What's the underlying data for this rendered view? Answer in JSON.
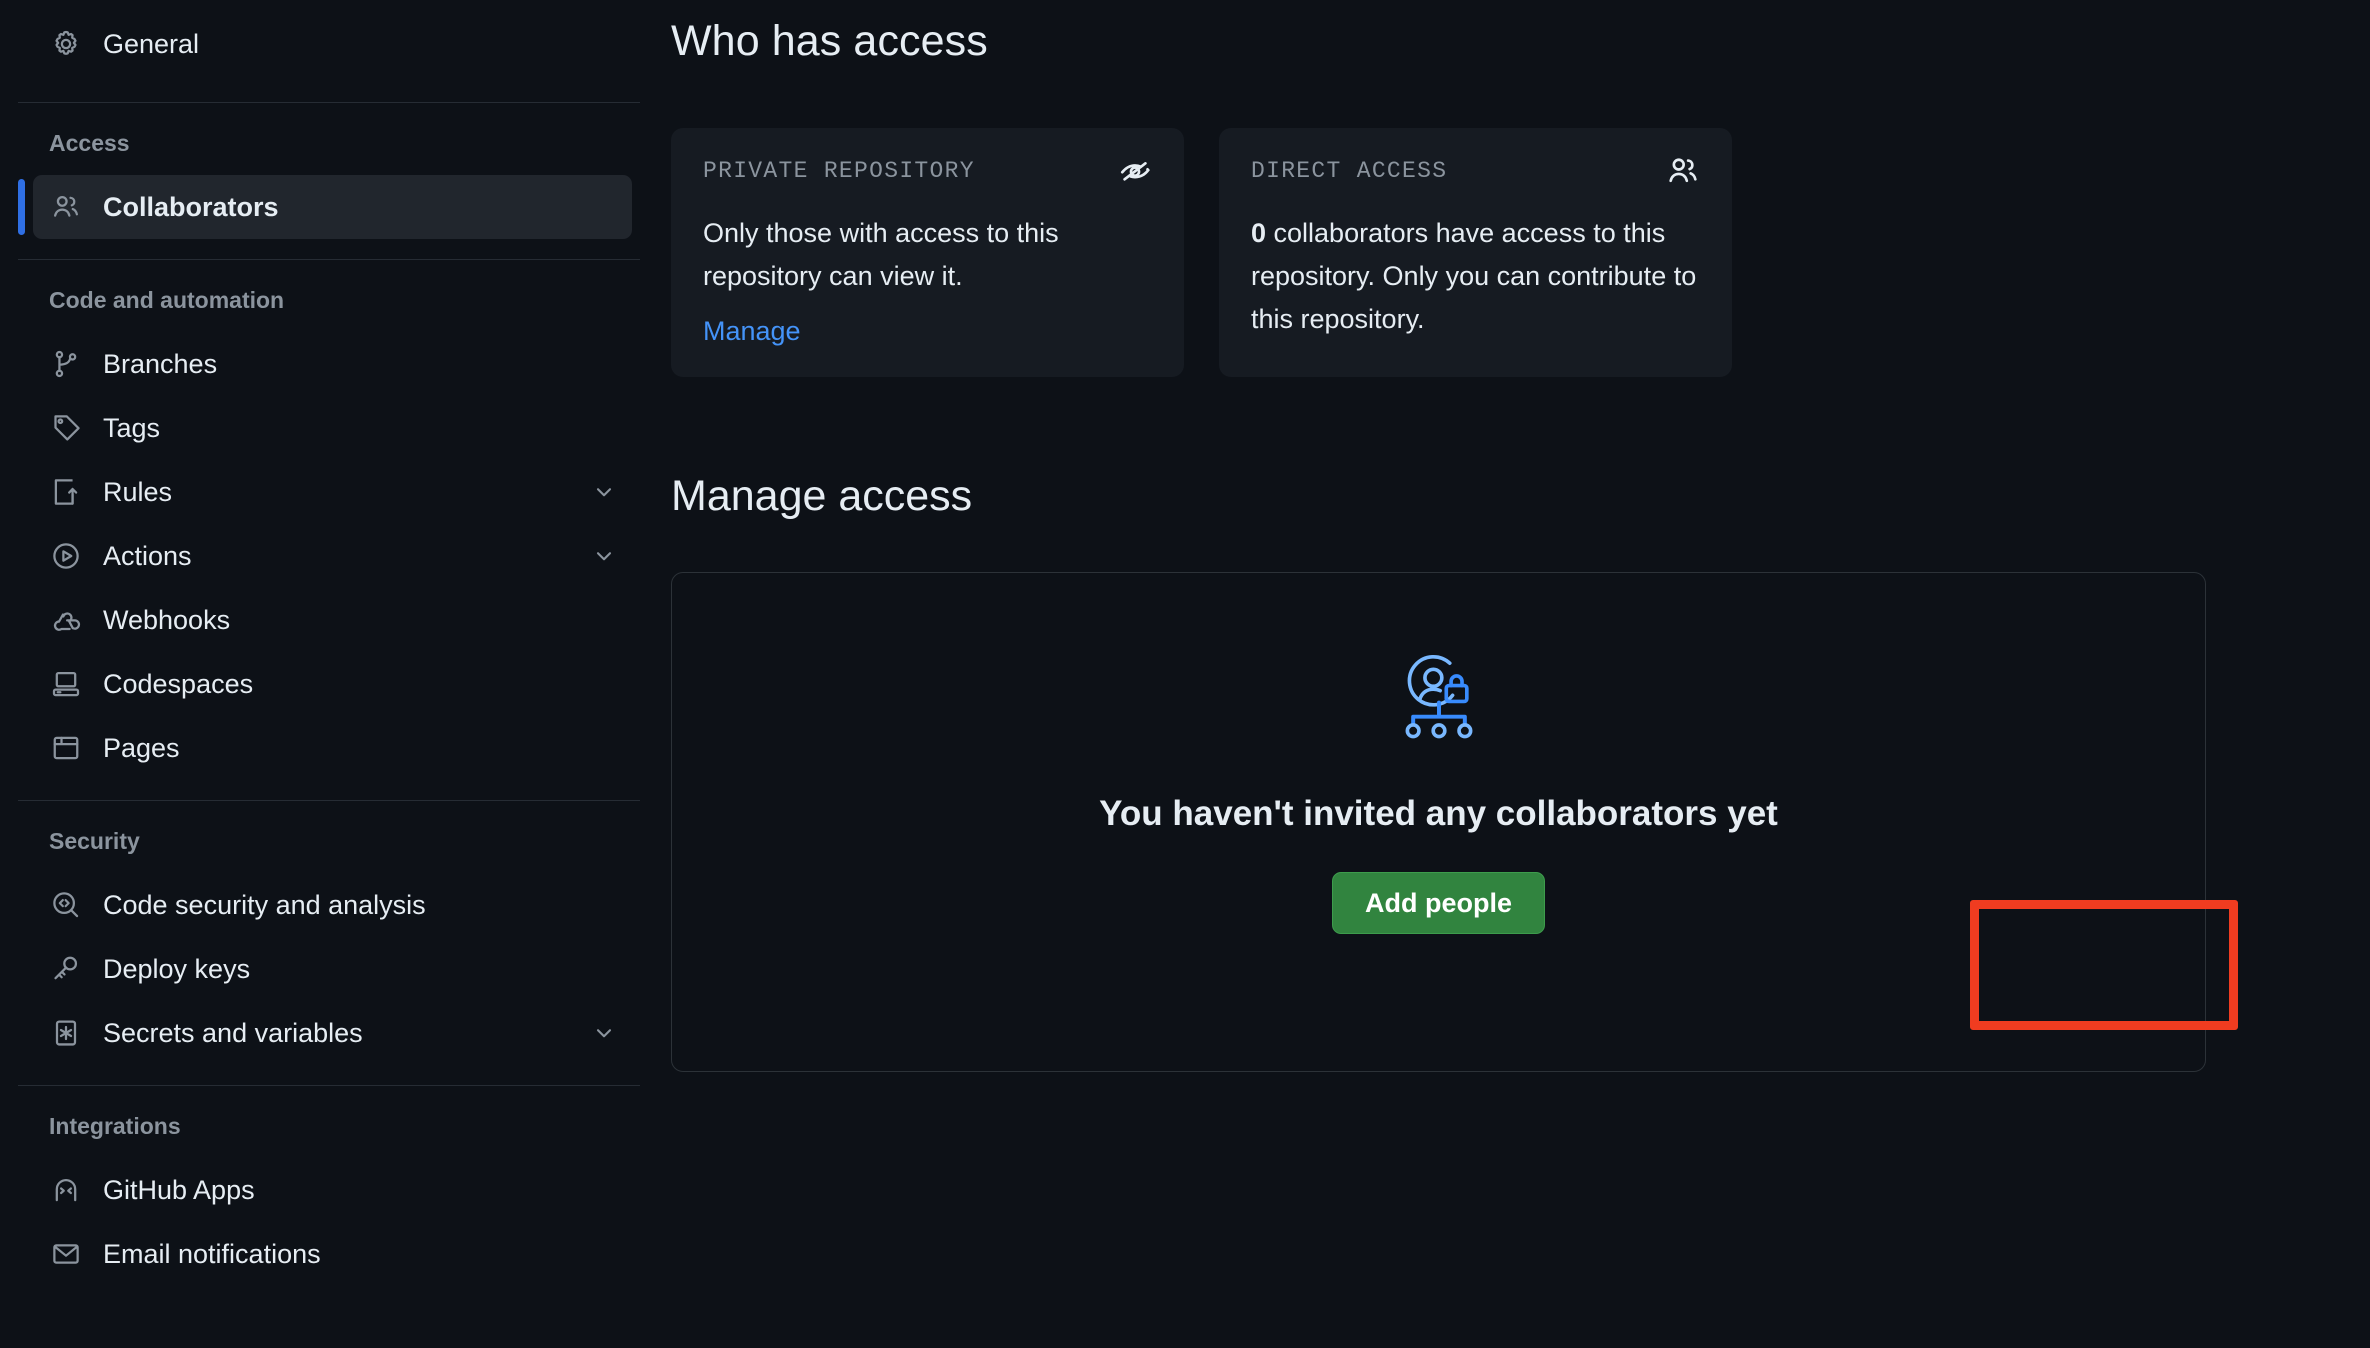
{
  "sidebar": {
    "top_items": [
      {
        "label": "General",
        "icon": "gear-icon",
        "name": "sidebar-item-general"
      }
    ],
    "sections": [
      {
        "title": "Access",
        "name": "sidebar-section-access",
        "items": [
          {
            "label": "Collaborators",
            "icon": "people-icon",
            "name": "sidebar-item-collaborators",
            "active": true,
            "expandable": false
          }
        ]
      },
      {
        "title": "Code and automation",
        "name": "sidebar-section-code-and-automation",
        "items": [
          {
            "label": "Branches",
            "icon": "git-branch-icon",
            "name": "sidebar-item-branches",
            "active": false,
            "expandable": false
          },
          {
            "label": "Tags",
            "icon": "tag-icon",
            "name": "sidebar-item-tags",
            "active": false,
            "expandable": false
          },
          {
            "label": "Rules",
            "icon": "rules-icon",
            "name": "sidebar-item-rules",
            "active": false,
            "expandable": true
          },
          {
            "label": "Actions",
            "icon": "play-circle-icon",
            "name": "sidebar-item-actions",
            "active": false,
            "expandable": true
          },
          {
            "label": "Webhooks",
            "icon": "webhook-icon",
            "name": "sidebar-item-webhooks",
            "active": false,
            "expandable": false
          },
          {
            "label": "Codespaces",
            "icon": "codespaces-icon",
            "name": "sidebar-item-codespaces",
            "active": false,
            "expandable": false
          },
          {
            "label": "Pages",
            "icon": "browser-icon",
            "name": "sidebar-item-pages",
            "active": false,
            "expandable": false
          }
        ]
      },
      {
        "title": "Security",
        "name": "sidebar-section-security",
        "items": [
          {
            "label": "Code security and analysis",
            "icon": "code-scan-icon",
            "name": "sidebar-item-code-security-and-analysis",
            "active": false,
            "expandable": false
          },
          {
            "label": "Deploy keys",
            "icon": "key-icon",
            "name": "sidebar-item-deploy-keys",
            "active": false,
            "expandable": false
          },
          {
            "label": "Secrets and variables",
            "icon": "asterisk-box-icon",
            "name": "sidebar-item-secrets-and-variables",
            "active": false,
            "expandable": true
          }
        ]
      },
      {
        "title": "Integrations",
        "name": "sidebar-section-integrations",
        "items": [
          {
            "label": "GitHub Apps",
            "icon": "github-apps-icon",
            "name": "sidebar-item-github-apps",
            "active": false,
            "expandable": false
          },
          {
            "label": "Email notifications",
            "icon": "mail-icon",
            "name": "sidebar-item-email-notifications",
            "active": false,
            "expandable": false
          }
        ]
      }
    ]
  },
  "main": {
    "who_has_access_heading": "Who has access",
    "cards": [
      {
        "kicker": "PRIVATE REPOSITORY",
        "icon": "eye-closed-icon",
        "body": "Only those with access to this repository can view it.",
        "link_label": "Manage",
        "name": "private-repository-card"
      },
      {
        "kicker": "DIRECT ACCESS",
        "icon": "people-icon",
        "count": "0",
        "body": " collaborators have access to this repository. Only you can contribute to this repository.",
        "name": "direct-access-card"
      }
    ],
    "manage_access_heading": "Manage access",
    "empty_state": {
      "illustration": "collaborators-lock-illustration",
      "title": "You haven't invited any collaborators yet",
      "button_label": "Add people"
    }
  },
  "colors": {
    "page_background": "#0d1117",
    "card_background": "#161b22",
    "accent_blue": "#4493f8",
    "active_indicator": "#2f6fe4",
    "primary_button": "#31843f",
    "highlight_border": "#f03c20",
    "muted_text": "#8b949e",
    "body_text": "#e6edf3"
  }
}
